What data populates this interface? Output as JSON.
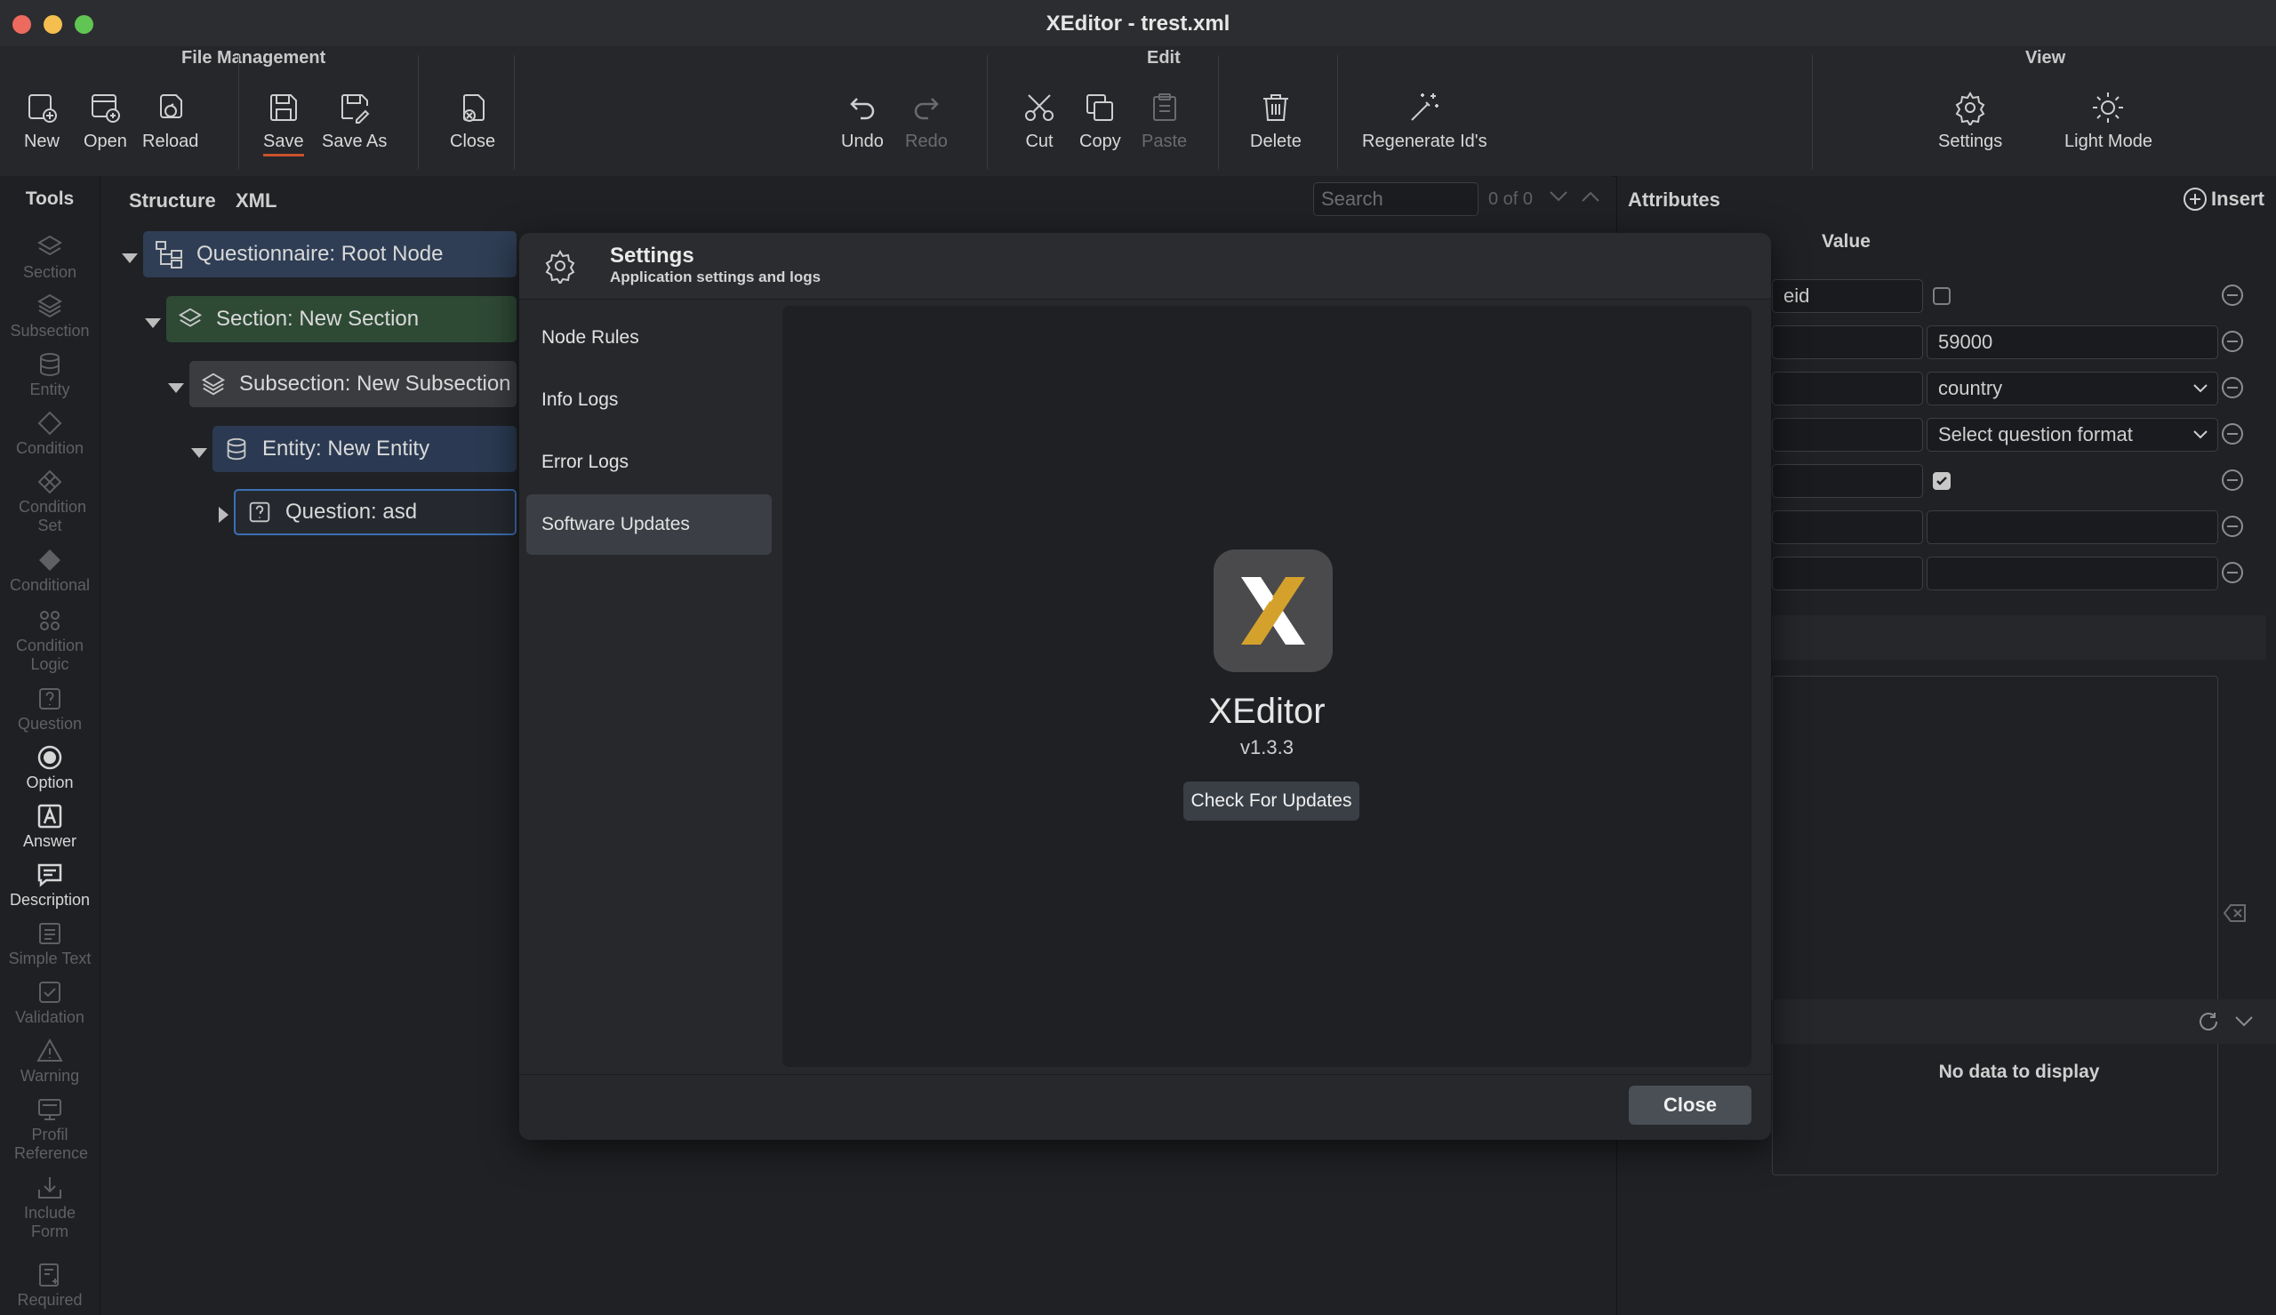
{
  "window": {
    "title": "XEditor - trest.xml"
  },
  "toolbar": {
    "groups": {
      "file": "File Management",
      "edit": "Edit",
      "view": "View"
    },
    "new": "New",
    "open": "Open",
    "reload": "Reload",
    "save": "Save",
    "save_as": "Save As",
    "close": "Close",
    "undo": "Undo",
    "redo": "Redo",
    "cut": "Cut",
    "copy": "Copy",
    "paste": "Paste",
    "delete": "Delete",
    "regenerate": "Regenerate Id's",
    "settings": "Settings",
    "light_mode": "Light Mode"
  },
  "tools": {
    "title": "Tools",
    "items": [
      "Section",
      "Subsection",
      "Entity",
      "Condition",
      "Condition Set",
      "Conditional",
      "Condition Logic",
      "Question",
      "Option",
      "Answer",
      "Description",
      "Simple Text",
      "Validation",
      "Warning",
      "Profil Reference",
      "Include Form",
      "Required"
    ]
  },
  "structure": {
    "tabs": {
      "structure": "Structure",
      "xml": "XML"
    },
    "search_placeholder": "Search",
    "search_count": "0 of 0",
    "nodes": {
      "root": "Questionnaire: Root Node",
      "section": "Section: New Section",
      "subsection": "Subsection: New Subsection",
      "entity": "Entity: New Entity",
      "question": "Question: asd"
    }
  },
  "attributes": {
    "title": "Attributes",
    "insert": "Insert",
    "value_header": "Value",
    "rows": {
      "r1_name": "eid",
      "r2_value": "59000",
      "r3_value": "country",
      "r4_value": "Select question format"
    },
    "empty": "No data to display"
  },
  "settings_modal": {
    "title": "Settings",
    "subtitle": "Application settings and logs",
    "nav": [
      "Node Rules",
      "Info Logs",
      "Error Logs",
      "Software Updates"
    ],
    "app_name": "XEditor",
    "version": "v1.3.3",
    "check_updates": "Check For Updates",
    "close": "Close"
  },
  "colors": {
    "accent_save": "#c9532c",
    "logo_gold": "#d4a22c",
    "section_node": "#2e4a35",
    "root_node": "#2f3e55"
  }
}
